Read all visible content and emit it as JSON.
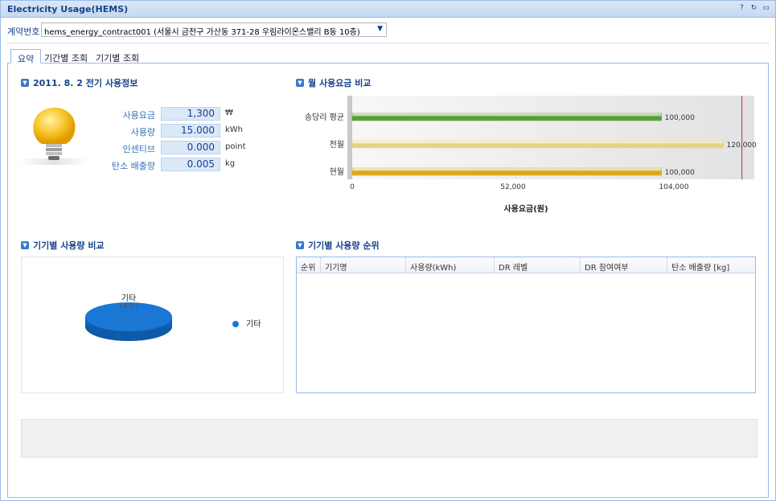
{
  "window": {
    "title": "Electricity Usage(HEMS)"
  },
  "contract": {
    "label": "계약번호",
    "value": "hems_energy_contract001 (서울시 금천구 가산동 371-28 우림라이온스밸리 B동 10층)"
  },
  "tabs": [
    {
      "label": "요약"
    },
    {
      "label": "기간별 조회"
    },
    {
      "label": "기기별 조회"
    }
  ],
  "usage_info": {
    "title": "2011. 8. 2 전기 사용정보",
    "rows": [
      {
        "label": "사용요금",
        "value": "1,300",
        "unit": "₩"
      },
      {
        "label": "사용량",
        "value": "15.000",
        "unit": "kWh"
      },
      {
        "label": "인센티브",
        "value": "0.000",
        "unit": "point"
      },
      {
        "label": "탄소 배출량",
        "value": "0.005",
        "unit": "kg"
      }
    ]
  },
  "monthly_compare": {
    "title": "월 사용요금 비교"
  },
  "device_compare": {
    "title": "기기별 사용량 비교"
  },
  "device_rank": {
    "title": "기기별 사용량 순위",
    "columns": [
      "순위",
      "기기명",
      "사용량(kWh)",
      "DR 레벨",
      "DR 참여여부",
      "탄소 배출량 [kg]"
    ]
  },
  "chart_data": [
    {
      "type": "bar",
      "orientation": "horizontal",
      "categories": [
        "송당리 평균",
        "전월",
        "현월"
      ],
      "values": [
        100000,
        120000,
        100000
      ],
      "data_labels": [
        "100,000",
        "120,000",
        "100,000"
      ],
      "xlabel": "사용요금(원)",
      "xticks": [
        "0",
        "52,000",
        "104,000"
      ],
      "xlim": [
        0,
        130000
      ],
      "reference_line": 126000,
      "colors": [
        "#4e9a2a",
        "#e4d27a",
        "#d7a40f"
      ]
    },
    {
      "type": "pie",
      "labels": [
        "기타"
      ],
      "values": [
        14.07
      ],
      "value_labels": [
        "14.07"
      ],
      "legend": [
        "기타"
      ],
      "legend_position": "right",
      "colors": [
        "#1a78d4"
      ]
    }
  ]
}
